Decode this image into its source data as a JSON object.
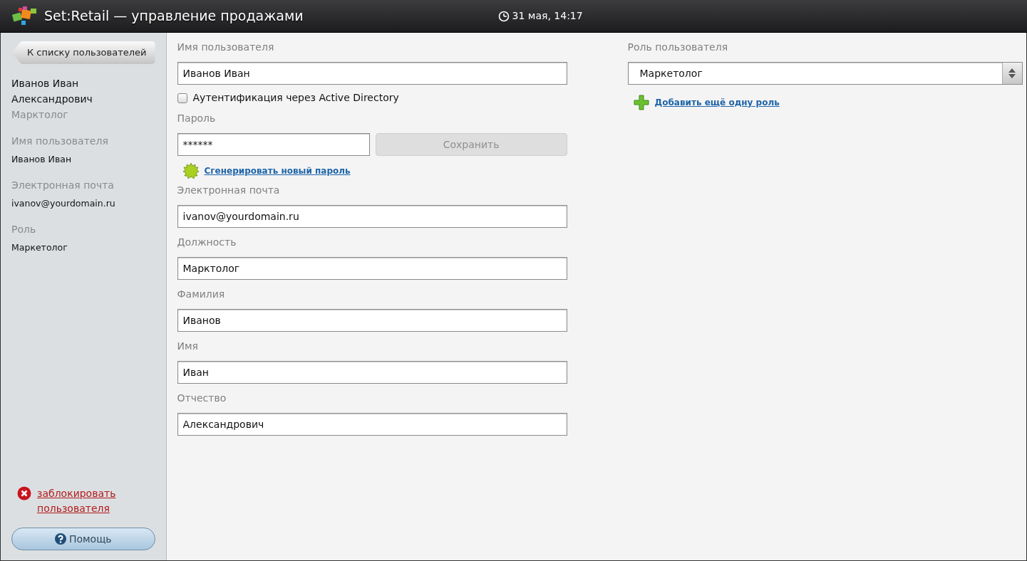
{
  "header": {
    "title": "Set:Retail — управление продажами",
    "datetime": "31 мая, 14:17"
  },
  "sidebar": {
    "back_button": "К списку пользователей",
    "full_name": "Иванов Иван Александрович",
    "position": "Марктолог",
    "details": [
      {
        "label": "Имя пользователя",
        "value": "Иванов Иван"
      },
      {
        "label": "Электронная почта",
        "value": "ivanov@yourdomain.ru"
      },
      {
        "label": "Роль",
        "value": "Маркетолог"
      }
    ],
    "block_link": "заблокировать пользователя",
    "help_button": "Помощь"
  },
  "form": {
    "username": {
      "label": "Имя пользователя",
      "value": "Иванов Иван"
    },
    "ad_auth": {
      "label": "Аутентификация через Active Directory",
      "checked": false
    },
    "password": {
      "label": "Пароль",
      "value": "******"
    },
    "save_button": {
      "label": "Сохранить",
      "disabled": true
    },
    "generate_link": "Сгенерировать новый пароль",
    "fields": [
      {
        "label": "Электронная почта",
        "value": "ivanov@yourdomain.ru"
      },
      {
        "label": "Должность",
        "value": "Марктолог"
      },
      {
        "label": "Фамилия",
        "value": "Иванов"
      },
      {
        "label": "Имя",
        "value": "Иван"
      },
      {
        "label": "Отчество",
        "value": "Александрович"
      }
    ]
  },
  "role": {
    "label": "Роль пользователя",
    "value": "Маркетолог",
    "add_link": "Добавить ещё одну роль"
  }
}
